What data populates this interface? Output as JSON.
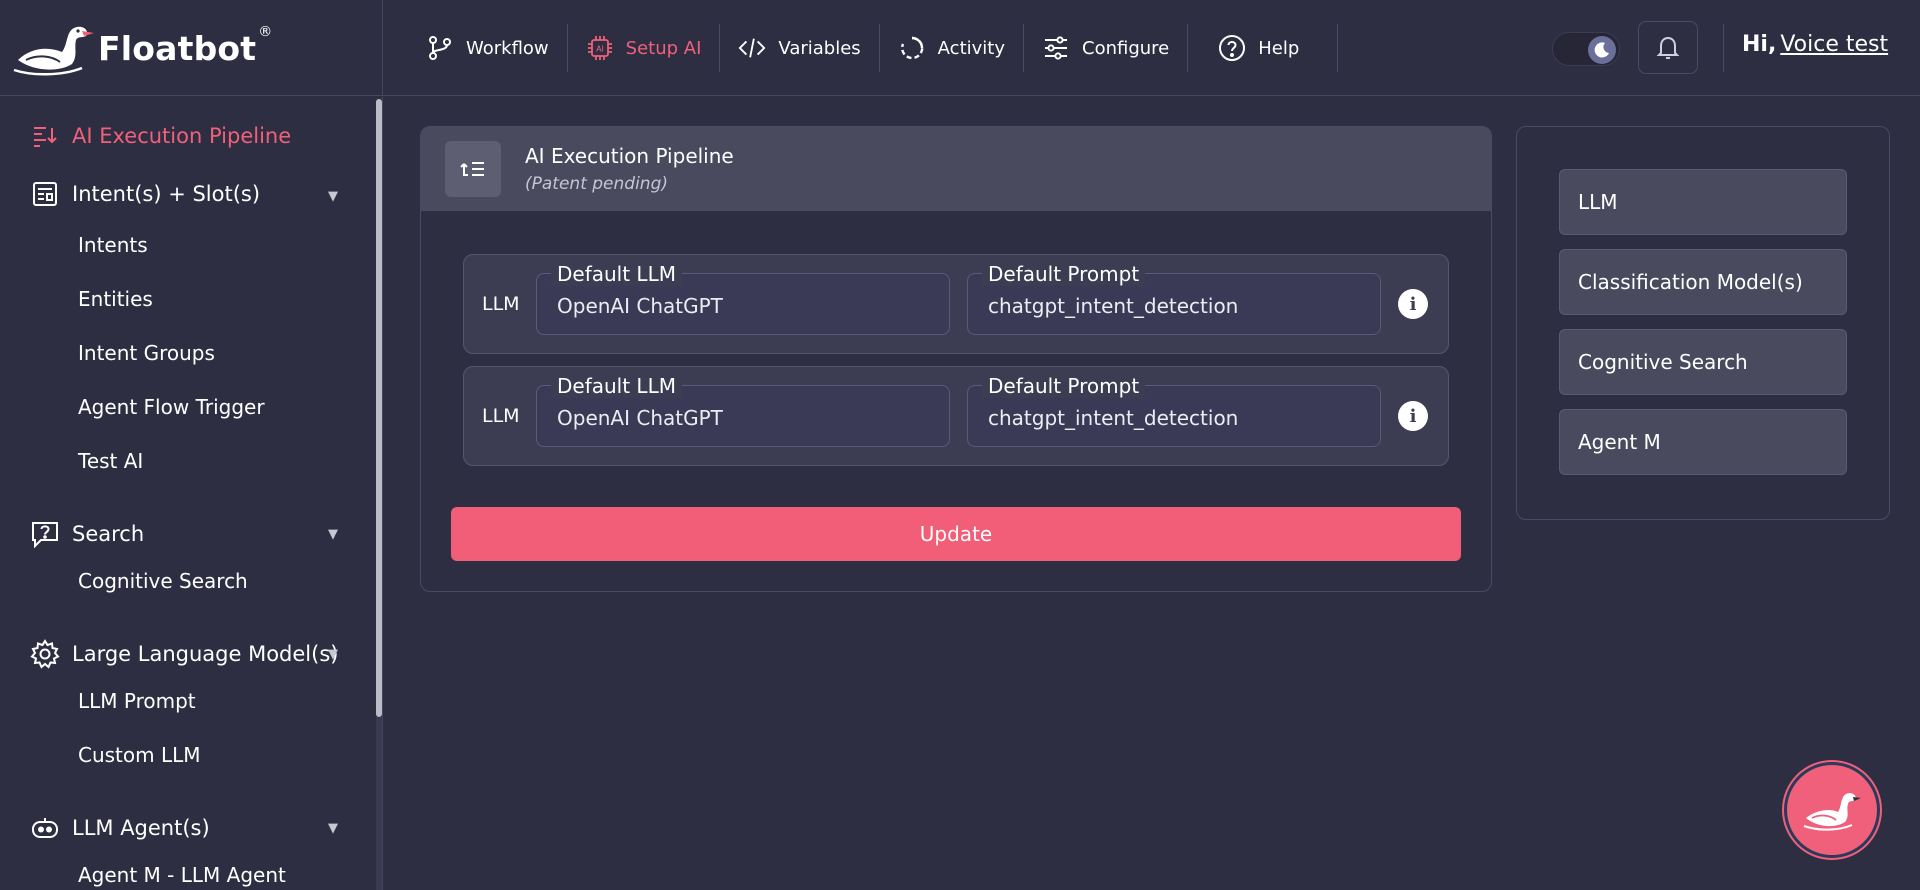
{
  "brand": {
    "name": "Floatbot",
    "reg": "®"
  },
  "nav": [
    {
      "label": "Workflow",
      "icon": "workflow-icon",
      "active": false
    },
    {
      "label": "Setup AI",
      "icon": "ai-chip-icon",
      "active": true
    },
    {
      "label": "Variables",
      "icon": "code-icon",
      "active": false
    },
    {
      "label": "Activity",
      "icon": "activity-icon",
      "active": false
    },
    {
      "label": "Configure",
      "icon": "sliders-icon",
      "active": false
    },
    {
      "label": "Help",
      "icon": "help-icon",
      "active": false
    }
  ],
  "user": {
    "greeting": "Hi,",
    "name": "Voice test"
  },
  "sidebar": {
    "active_item": "AI Execution Pipeline",
    "groups": [
      {
        "label": "Intent(s) + Slot(s)",
        "icon": "intent-icon",
        "children": [
          "Intents",
          "Entities",
          "Intent Groups",
          "Agent Flow Trigger",
          "Test AI"
        ]
      },
      {
        "label": "Search",
        "icon": "question-icon",
        "children": [
          "Cognitive Search"
        ]
      },
      {
        "label": "Large Language Model(s)",
        "icon": "gear-icon",
        "children": [
          "LLM Prompt",
          "Custom LLM"
        ]
      },
      {
        "label": "LLM Agent(s)",
        "icon": "robot-icon",
        "children": [
          "Agent M - LLM Agent"
        ]
      }
    ]
  },
  "pipeline": {
    "title": "AI Execution Pipeline",
    "subtitle": "(Patent pending)",
    "rows": [
      {
        "label": "LLM",
        "llm_label": "Default LLM",
        "llm_value": "OpenAI ChatGPT",
        "prompt_label": "Default Prompt",
        "prompt_value": "chatgpt_intent_detection"
      },
      {
        "label": "LLM",
        "llm_label": "Default LLM",
        "llm_value": "OpenAI ChatGPT",
        "prompt_label": "Default Prompt",
        "prompt_value": "chatgpt_intent_detection"
      }
    ],
    "update_label": "Update"
  },
  "right_panel": {
    "buttons": [
      "LLM",
      "Classification Model(s)",
      "Cognitive Search",
      "Agent M"
    ]
  },
  "colors": {
    "accent": "#f0607a",
    "background": "#2e2e42",
    "card_header": "#494a5e"
  }
}
